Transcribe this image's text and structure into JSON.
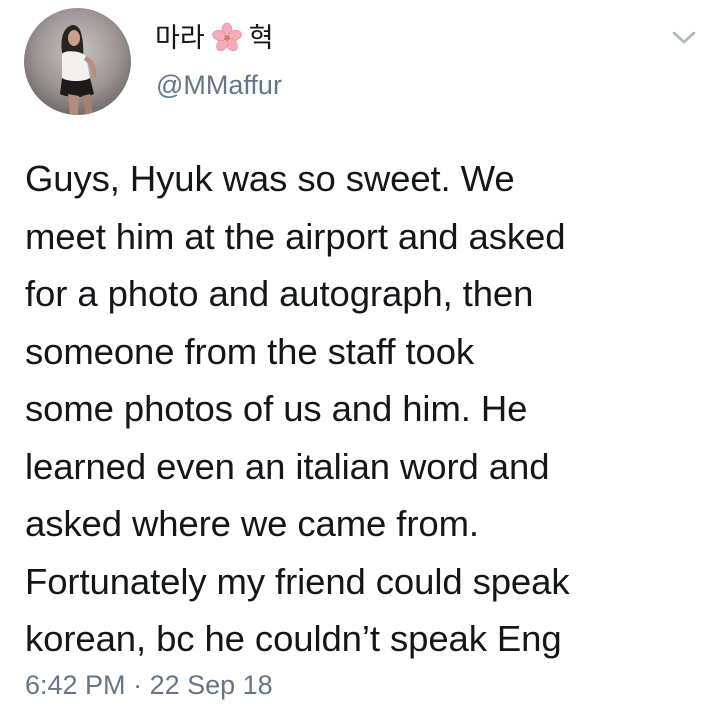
{
  "tweet": {
    "author": {
      "name_prefix": "마라",
      "name_emoji": "cherry-blossom-icon",
      "name_suffix": "혁",
      "handle": "@MMaffur"
    },
    "text_lines": [
      "Guys, Hyuk was so sweet. We",
      "meet him at the airport and asked",
      "for a photo and autograph, then",
      "someone from the staff took",
      "some photos of us and him. He",
      "learned even an italian word and",
      "asked where we came from.",
      "Fortunately my friend could speak",
      "korean, bc he couldn’t speak Eng"
    ],
    "time": "6:42 PM",
    "separator": "·",
    "date": "22 Sep 18"
  },
  "colors": {
    "text_primary": "#14171a",
    "text_secondary": "#657786",
    "caret": "#aab8c2",
    "blossom": "#f4abba"
  }
}
